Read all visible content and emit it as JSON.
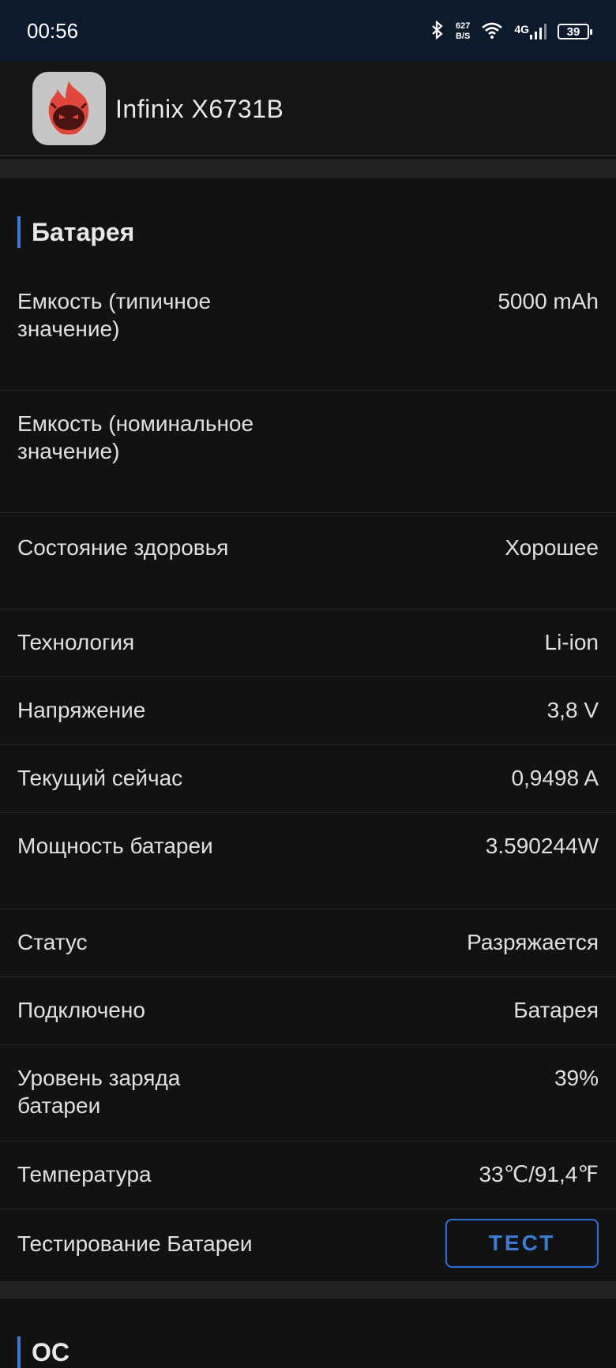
{
  "status_bar": {
    "time": "00:56",
    "speed_value": "627",
    "speed_unit": "B/S",
    "network": "4G",
    "battery": "39"
  },
  "app": {
    "title": "Infinix X6731B",
    "logo_icon": "antutu-flame-icon"
  },
  "battery_section": {
    "title": "Батарея",
    "rows": [
      {
        "label": "Емкость (типичное значение)",
        "value": "5000 mAh"
      },
      {
        "label": "Емкость (номинальное значение)",
        "value": ""
      },
      {
        "label": "Состояние здоровья",
        "value": "Хорошее"
      },
      {
        "label": "Технология",
        "value": "Li-ion"
      },
      {
        "label": "Напряжение",
        "value": "3,8 V"
      },
      {
        "label": "Текущий сейчас",
        "value": "0,9498 A"
      },
      {
        "label": "Мощность батареи",
        "value": "3.590244W"
      },
      {
        "label": "Статус",
        "value": "Разряжается"
      },
      {
        "label": "Подключено",
        "value": "Батарея"
      },
      {
        "label": "Уровень заряда батареи",
        "value": "39%"
      },
      {
        "label": "Температура",
        "value": "33℃/91,4℉"
      }
    ],
    "test_row": {
      "label": "Тестирование Батареи",
      "button": "ТЕСТ"
    }
  },
  "os_section": {
    "title": "ОС"
  },
  "colors": {
    "accent": "#3a7bd5",
    "background": "#121212",
    "status_bar": "#0d1a2c"
  }
}
